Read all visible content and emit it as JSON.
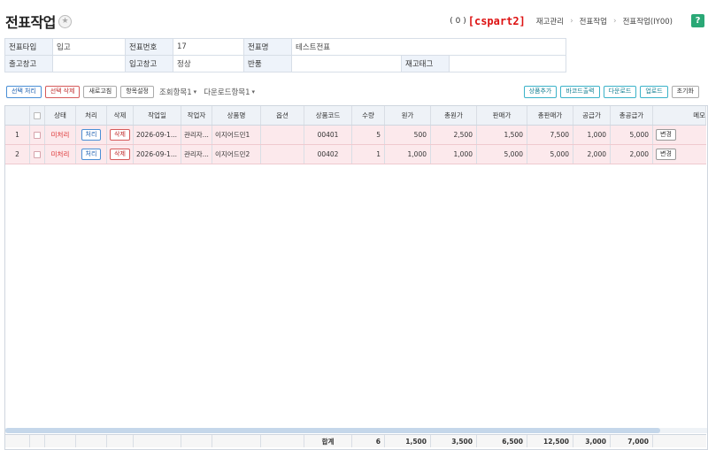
{
  "header": {
    "title": "전표작업",
    "count": "( 0 )",
    "brand": "[cspart2]",
    "breadcrumb": [
      "재고관리",
      "전표작업",
      "전표작업(IY00)"
    ],
    "help": "?"
  },
  "info": {
    "row1": [
      {
        "label": "전표타입",
        "value": "입고"
      },
      {
        "label": "전표번호",
        "value": "17"
      },
      {
        "label": "전표명",
        "value": "테스트전표"
      }
    ],
    "row2": [
      {
        "label": "출고창고",
        "value": ""
      },
      {
        "label": "입고창고",
        "value": "정상"
      },
      {
        "label": "반품",
        "value": ""
      },
      {
        "label": "재고태그",
        "value": ""
      }
    ]
  },
  "toolbar": {
    "select_process": "선택 처리",
    "select_delete": "선택 삭제",
    "refresh": "새로고침",
    "column_settings": "항목설정",
    "view_items": "조회항목1",
    "download_items": "다운로드항목1",
    "add_product": "상품추가",
    "barcode_print": "바코드출력",
    "download": "다운로드",
    "upload": "업로드",
    "reset": "초기화"
  },
  "grid": {
    "columns": [
      "상태",
      "처리",
      "삭제",
      "작업일",
      "작업자",
      "상품명",
      "옵션",
      "상품코드",
      "수량",
      "원가",
      "총원가",
      "판매가",
      "총판매가",
      "공급가",
      "총공급가",
      "메모"
    ],
    "rows": [
      {
        "no": "1",
        "status": "미처리",
        "process": "처리",
        "delete": "삭제",
        "date": "2026-09-1...",
        "worker": "관리자...",
        "product": "이지어드민1",
        "option": "",
        "code": "00401",
        "qty": "5",
        "cost": "500",
        "total_cost": "2,500",
        "price": "1,500",
        "total_price": "7,500",
        "supply": "1,000",
        "total_supply": "5,000",
        "memo": "변경"
      },
      {
        "no": "2",
        "status": "미처리",
        "process": "처리",
        "delete": "삭제",
        "date": "2026-09-1...",
        "worker": "관리자...",
        "product": "이지어드민2",
        "option": "",
        "code": "00402",
        "qty": "1",
        "cost": "1,000",
        "total_cost": "1,000",
        "price": "5,000",
        "total_price": "5,000",
        "supply": "2,000",
        "total_supply": "2,000",
        "memo": "변경"
      }
    ],
    "footer": {
      "label": "합계",
      "qty": "6",
      "cost": "1,500",
      "total_cost": "3,500",
      "price": "6,500",
      "total_price": "12,500",
      "supply": "3,000",
      "total_supply": "7,000"
    }
  }
}
